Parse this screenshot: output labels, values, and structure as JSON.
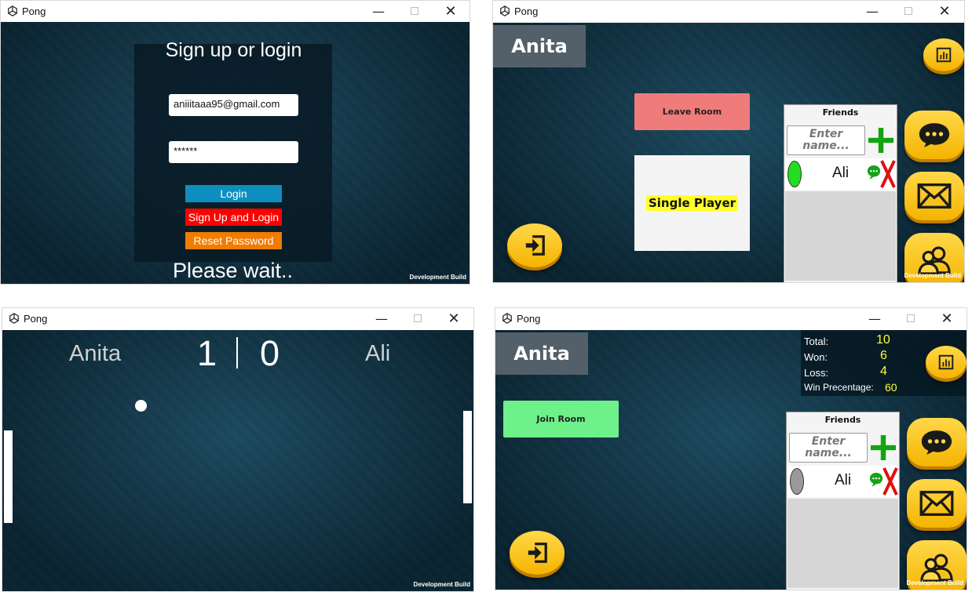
{
  "app_title": "Pong",
  "dev_build": "Development Build",
  "login": {
    "title": "Sign up or login",
    "email_value": "aniiitaaa95@gmail.com",
    "password_value": "******",
    "login_btn": "Login",
    "signup_btn": "Sign Up and Login",
    "reset_btn": "Reset Password",
    "wait_text": "Please wait..",
    "colors": {
      "login": "#0e8ebf",
      "signup": "#ff0000",
      "reset": "#f07c00"
    }
  },
  "lobby1": {
    "player_name": "Anita",
    "leave_room": "Leave Room",
    "single_player": "Single Player",
    "friends_title": "Friends",
    "friend_placeholder": "Enter name...",
    "friend_name": "Ali",
    "friend_status_color": "#22dd22"
  },
  "game": {
    "player_left": "Anita",
    "player_right": "Ali",
    "score_left": "1",
    "score_right": "0"
  },
  "lobby2": {
    "player_name": "Anita",
    "join_room": "Join Room",
    "friends_title": "Friends",
    "friend_placeholder": "Enter name...",
    "friend_name": "Ali",
    "friend_status_color": "#999999",
    "stats": {
      "total_label": "Total:",
      "total_value": "10",
      "won_label": "Won:",
      "won_value": "6",
      "loss_label": "Loss:",
      "loss_value": "4",
      "win_pct_label": "Win Precentage:",
      "win_pct_value": "60"
    }
  },
  "icons": [
    "unity-icon",
    "minimize-icon",
    "maximize-icon",
    "close-icon",
    "leaderboard-icon",
    "chat-icon",
    "mail-icon",
    "users-icon",
    "exit-icon",
    "add-friend-icon",
    "remove-friend-icon"
  ]
}
